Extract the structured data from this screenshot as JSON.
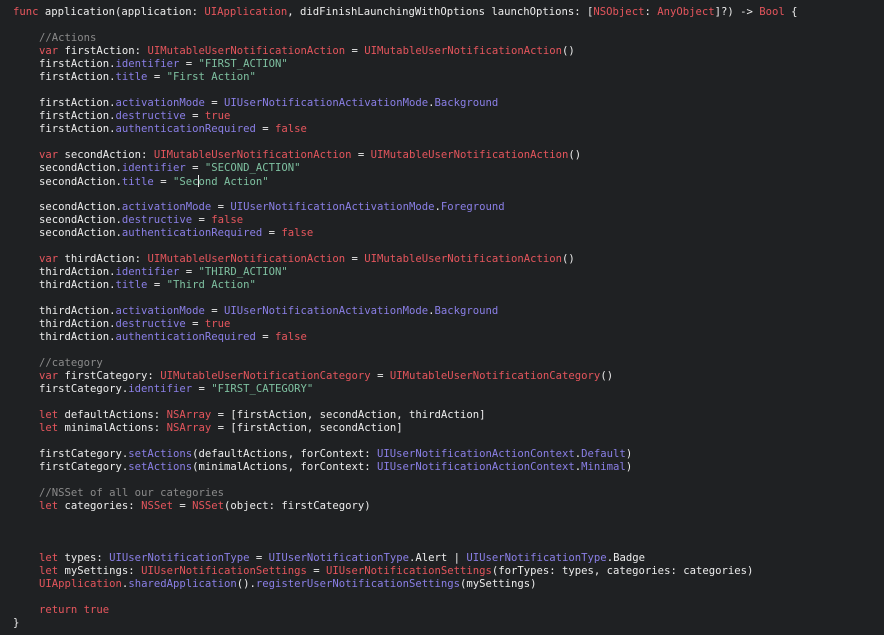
{
  "editor": {
    "lines": [
      [
        {
          "t": "func",
          "c": "kw"
        },
        {
          "t": " application(application: ",
          "c": "plain"
        },
        {
          "t": "UIApplication",
          "c": "type"
        },
        {
          "t": ", didFinishLaunchingWithOptions launchOptions: [",
          "c": "plain"
        },
        {
          "t": "NSObject",
          "c": "type"
        },
        {
          "t": ": ",
          "c": "plain"
        },
        {
          "t": "AnyObject",
          "c": "type"
        },
        {
          "t": "]?) -> ",
          "c": "plain"
        },
        {
          "t": "Bool",
          "c": "type"
        },
        {
          "t": " {",
          "c": "plain"
        }
      ],
      [],
      [
        {
          "t": "//Actions",
          "c": "cmt"
        }
      ],
      [
        {
          "t": "var",
          "c": "kw"
        },
        {
          "t": " firstAction: ",
          "c": "plain"
        },
        {
          "t": "UIMutableUserNotificationAction",
          "c": "type"
        },
        {
          "t": " = ",
          "c": "plain"
        },
        {
          "t": "UIMutableUserNotificationAction",
          "c": "type"
        },
        {
          "t": "()",
          "c": "plain"
        }
      ],
      [
        {
          "t": "firstAction.",
          "c": "plain"
        },
        {
          "t": "identifier",
          "c": "cocoa"
        },
        {
          "t": " = ",
          "c": "plain"
        },
        {
          "t": "\"FIRST_ACTION\"",
          "c": "str"
        }
      ],
      [
        {
          "t": "firstAction.",
          "c": "plain"
        },
        {
          "t": "title",
          "c": "cocoa"
        },
        {
          "t": " = ",
          "c": "plain"
        },
        {
          "t": "\"First Action\"",
          "c": "str"
        }
      ],
      [],
      [
        {
          "t": "firstAction.",
          "c": "plain"
        },
        {
          "t": "activationMode",
          "c": "cocoa"
        },
        {
          "t": " = ",
          "c": "plain"
        },
        {
          "t": "UIUserNotificationActivationMode",
          "c": "cocoa"
        },
        {
          "t": ".",
          "c": "plain"
        },
        {
          "t": "Background",
          "c": "cocoa"
        }
      ],
      [
        {
          "t": "firstAction.",
          "c": "plain"
        },
        {
          "t": "destructive",
          "c": "cocoa"
        },
        {
          "t": " = ",
          "c": "plain"
        },
        {
          "t": "true",
          "c": "kw"
        }
      ],
      [
        {
          "t": "firstAction.",
          "c": "plain"
        },
        {
          "t": "authenticationRequired",
          "c": "cocoa"
        },
        {
          "t": " = ",
          "c": "plain"
        },
        {
          "t": "false",
          "c": "kw"
        }
      ],
      [],
      [
        {
          "t": "var",
          "c": "kw"
        },
        {
          "t": " secondAction: ",
          "c": "plain"
        },
        {
          "t": "UIMutableUserNotificationAction",
          "c": "type"
        },
        {
          "t": " = ",
          "c": "plain"
        },
        {
          "t": "UIMutableUserNotificationAction",
          "c": "type"
        },
        {
          "t": "()",
          "c": "plain"
        }
      ],
      [
        {
          "t": "secondAction.",
          "c": "plain"
        },
        {
          "t": "identifier",
          "c": "cocoa"
        },
        {
          "t": " = ",
          "c": "plain"
        },
        {
          "t": "\"SECOND_ACTION\"",
          "c": "str"
        }
      ],
      [
        {
          "t": "secondAction.",
          "c": "plain"
        },
        {
          "t": "title",
          "c": "cocoa"
        },
        {
          "t": " = ",
          "c": "plain"
        },
        {
          "t": "\"Sec",
          "c": "str"
        },
        {
          "caret": true
        },
        {
          "t": "ond Action\"",
          "c": "str"
        }
      ],
      [],
      [
        {
          "t": "secondAction.",
          "c": "plain"
        },
        {
          "t": "activationMode",
          "c": "cocoa"
        },
        {
          "t": " = ",
          "c": "plain"
        },
        {
          "t": "UIUserNotificationActivationMode",
          "c": "cocoa"
        },
        {
          "t": ".",
          "c": "plain"
        },
        {
          "t": "Foreground",
          "c": "cocoa"
        }
      ],
      [
        {
          "t": "secondAction.",
          "c": "plain"
        },
        {
          "t": "destructive",
          "c": "cocoa"
        },
        {
          "t": " = ",
          "c": "plain"
        },
        {
          "t": "false",
          "c": "kw"
        }
      ],
      [
        {
          "t": "secondAction.",
          "c": "plain"
        },
        {
          "t": "authenticationRequired",
          "c": "cocoa"
        },
        {
          "t": " = ",
          "c": "plain"
        },
        {
          "t": "false",
          "c": "kw"
        }
      ],
      [],
      [
        {
          "t": "var",
          "c": "kw"
        },
        {
          "t": " thirdAction: ",
          "c": "plain"
        },
        {
          "t": "UIMutableUserNotificationAction",
          "c": "type"
        },
        {
          "t": " = ",
          "c": "plain"
        },
        {
          "t": "UIMutableUserNotificationAction",
          "c": "type"
        },
        {
          "t": "()",
          "c": "plain"
        }
      ],
      [
        {
          "t": "thirdAction.",
          "c": "plain"
        },
        {
          "t": "identifier",
          "c": "cocoa"
        },
        {
          "t": " = ",
          "c": "plain"
        },
        {
          "t": "\"THIRD_ACTION\"",
          "c": "str"
        }
      ],
      [
        {
          "t": "thirdAction.",
          "c": "plain"
        },
        {
          "t": "title",
          "c": "cocoa"
        },
        {
          "t": " = ",
          "c": "plain"
        },
        {
          "t": "\"Third Action\"",
          "c": "str"
        }
      ],
      [],
      [
        {
          "t": "thirdAction.",
          "c": "plain"
        },
        {
          "t": "activationMode",
          "c": "cocoa"
        },
        {
          "t": " = ",
          "c": "plain"
        },
        {
          "t": "UIUserNotificationActivationMode",
          "c": "cocoa"
        },
        {
          "t": ".",
          "c": "plain"
        },
        {
          "t": "Background",
          "c": "cocoa"
        }
      ],
      [
        {
          "t": "thirdAction.",
          "c": "plain"
        },
        {
          "t": "destructive",
          "c": "cocoa"
        },
        {
          "t": " = ",
          "c": "plain"
        },
        {
          "t": "true",
          "c": "kw"
        }
      ],
      [
        {
          "t": "thirdAction.",
          "c": "plain"
        },
        {
          "t": "authenticationRequired",
          "c": "cocoa"
        },
        {
          "t": " = ",
          "c": "plain"
        },
        {
          "t": "false",
          "c": "kw"
        }
      ],
      [],
      [
        {
          "t": "//category",
          "c": "cmt"
        }
      ],
      [
        {
          "t": "var",
          "c": "kw"
        },
        {
          "t": " firstCategory: ",
          "c": "plain"
        },
        {
          "t": "UIMutableUserNotificationCategory",
          "c": "type"
        },
        {
          "t": " = ",
          "c": "plain"
        },
        {
          "t": "UIMutableUserNotificationCategory",
          "c": "type"
        },
        {
          "t": "()",
          "c": "plain"
        }
      ],
      [
        {
          "t": "firstCategory.",
          "c": "plain"
        },
        {
          "t": "identifier",
          "c": "cocoa"
        },
        {
          "t": " = ",
          "c": "plain"
        },
        {
          "t": "\"FIRST_CATEGORY\"",
          "c": "str"
        }
      ],
      [],
      [
        {
          "t": "let",
          "c": "kw"
        },
        {
          "t": " defaultActions: ",
          "c": "plain"
        },
        {
          "t": "NSArray",
          "c": "type"
        },
        {
          "t": " = [firstAction, secondAction, thirdAction]",
          "c": "plain"
        }
      ],
      [
        {
          "t": "let",
          "c": "kw"
        },
        {
          "t": " minimalActions: ",
          "c": "plain"
        },
        {
          "t": "NSArray",
          "c": "type"
        },
        {
          "t": " = [firstAction, secondAction]",
          "c": "plain"
        }
      ],
      [],
      [
        {
          "t": "firstCategory.",
          "c": "plain"
        },
        {
          "t": "setActions",
          "c": "cocoa"
        },
        {
          "t": "(defaultActions, forContext: ",
          "c": "plain"
        },
        {
          "t": "UIUserNotificationActionContext",
          "c": "cocoa"
        },
        {
          "t": ".",
          "c": "plain"
        },
        {
          "t": "Default",
          "c": "cocoa"
        },
        {
          "t": ")",
          "c": "plain"
        }
      ],
      [
        {
          "t": "firstCategory.",
          "c": "plain"
        },
        {
          "t": "setActions",
          "c": "cocoa"
        },
        {
          "t": "(minimalActions, forContext: ",
          "c": "plain"
        },
        {
          "t": "UIUserNotificationActionContext",
          "c": "cocoa"
        },
        {
          "t": ".",
          "c": "plain"
        },
        {
          "t": "Minimal",
          "c": "cocoa"
        },
        {
          "t": ")",
          "c": "plain"
        }
      ],
      [],
      [
        {
          "t": "//NSSet of all our categories",
          "c": "cmt"
        }
      ],
      [
        {
          "t": "let",
          "c": "kw"
        },
        {
          "t": " categories: ",
          "c": "plain"
        },
        {
          "t": "NSSet",
          "c": "type"
        },
        {
          "t": " = ",
          "c": "plain"
        },
        {
          "t": "NSSet",
          "c": "type"
        },
        {
          "t": "(object: firstCategory)",
          "c": "plain"
        }
      ],
      [],
      [],
      [],
      [
        {
          "t": "let",
          "c": "kw"
        },
        {
          "t": " types: ",
          "c": "plain"
        },
        {
          "t": "UIUserNotificationType",
          "c": "cocoa"
        },
        {
          "t": " = ",
          "c": "plain"
        },
        {
          "t": "UIUserNotificationType",
          "c": "cocoa"
        },
        {
          "t": ".Alert | ",
          "c": "plain"
        },
        {
          "t": "UIUserNotificationType",
          "c": "cocoa"
        },
        {
          "t": ".Badge",
          "c": "plain"
        }
      ],
      [
        {
          "t": "let",
          "c": "kw"
        },
        {
          "t": " mySettings: ",
          "c": "plain"
        },
        {
          "t": "UIUserNotificationSettings",
          "c": "type"
        },
        {
          "t": " = ",
          "c": "plain"
        },
        {
          "t": "UIUserNotificationSettings",
          "c": "type"
        },
        {
          "t": "(forTypes: types, categories: categories)",
          "c": "plain"
        }
      ],
      [
        {
          "t": "UIApplication",
          "c": "type"
        },
        {
          "t": ".",
          "c": "plain"
        },
        {
          "t": "sharedApplication",
          "c": "cocoa"
        },
        {
          "t": "().",
          "c": "plain"
        },
        {
          "t": "registerUserNotificationSettings",
          "c": "cocoa"
        },
        {
          "t": "(mySettings)",
          "c": "plain"
        }
      ],
      [],
      [
        {
          "t": "return",
          "c": "kw"
        },
        {
          "t": " ",
          "c": "plain"
        },
        {
          "t": "true",
          "c": "kw"
        }
      ],
      [
        {
          "t": "}",
          "c": "plain"
        }
      ]
    ]
  }
}
